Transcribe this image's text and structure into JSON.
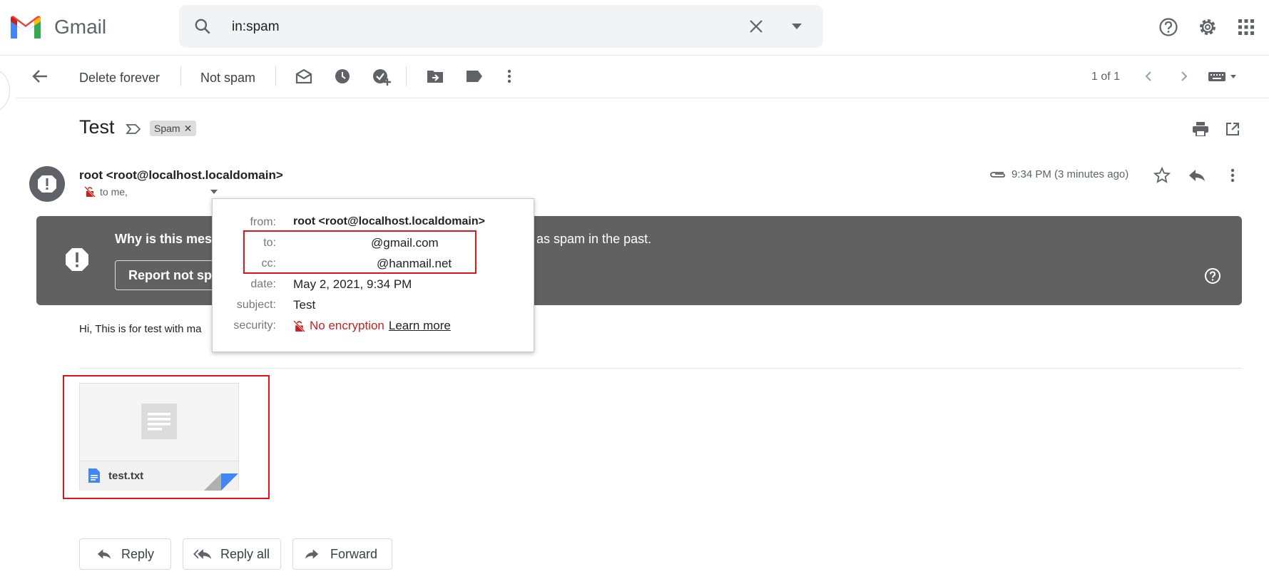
{
  "header": {
    "app_name": "Gmail",
    "search_value": "in:spam"
  },
  "toolbar": {
    "delete_forever": "Delete forever",
    "not_spam": "Not spam",
    "pagination": "1 of 1"
  },
  "message": {
    "subject": "Test",
    "label": "Spam",
    "sender": "root <root@localhost.localdomain>",
    "to_summary": "to me,",
    "time": "9:34 PM (3 minutes ago)",
    "body": "Hi, This is for test with ma"
  },
  "spam_banner": {
    "title": "Why is this mess",
    "explanation_tail": "ed as spam in the past.",
    "report_button": "Report not spam"
  },
  "details_popup": {
    "from_label": "from:",
    "from_value": "root <root@localhost.localdomain>",
    "to_label": "to:",
    "to_value": "@gmail.com",
    "cc_label": "cc:",
    "cc_value": "@hanmail.net",
    "date_label": "date:",
    "date_value": "May 2, 2021, 9:34 PM",
    "subject_label": "subject:",
    "subject_value": "Test",
    "security_label": "security:",
    "security_value": "No encryption",
    "learn_more": "Learn more"
  },
  "attachment": {
    "filename": "test.txt"
  },
  "actions": {
    "reply": "Reply",
    "reply_all": "Reply all",
    "forward": "Forward"
  },
  "colors": {
    "gmail_red": "#EA4335",
    "gmail_blue": "#4285F4",
    "gmail_green": "#34A853",
    "gmail_yellow": "#FBBC04",
    "highlight_red": "#E5121A",
    "banner_gray": "#616161",
    "security_red": "#C5221F"
  }
}
